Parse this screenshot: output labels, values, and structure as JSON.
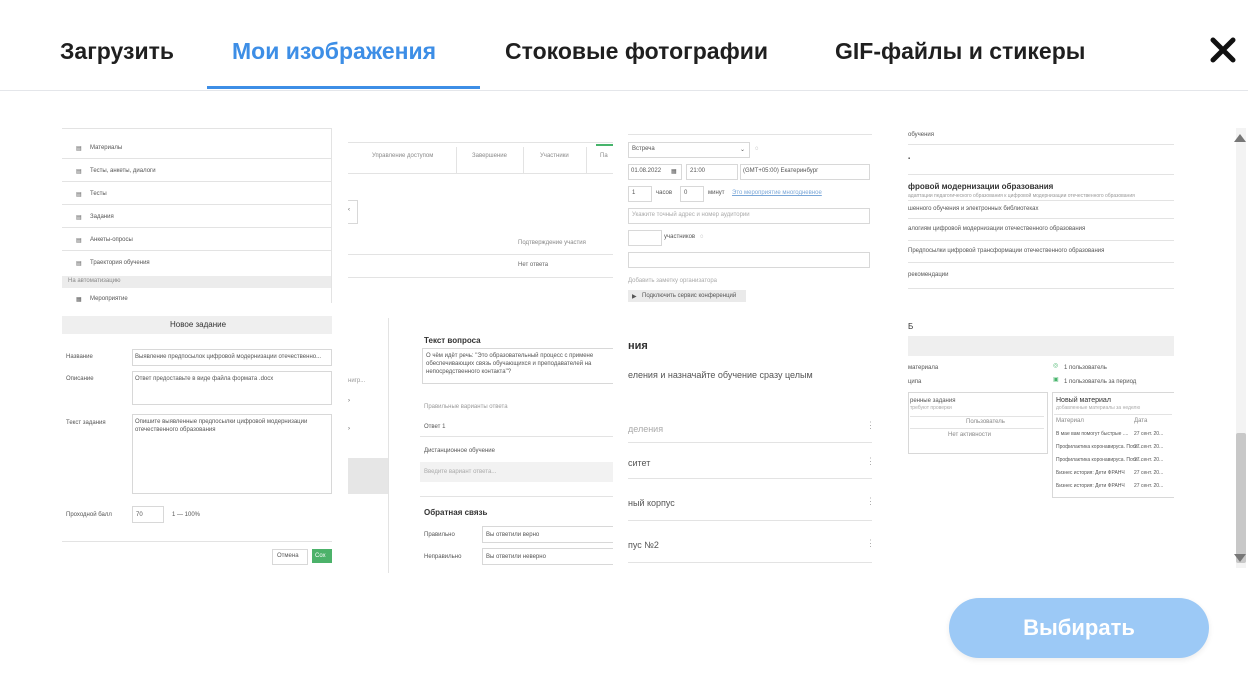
{
  "tabs": [
    {
      "label": "Загрузить"
    },
    {
      "label": "Мои изображения"
    },
    {
      "label": "Стоковые фотографии"
    },
    {
      "label": "GIF-файлы и стикеры"
    }
  ],
  "close_icon": "close-icon",
  "accent_color": "#3d8ee6",
  "button": {
    "select_label": "Выбирать",
    "color": "#9cc9f6"
  },
  "thumbs": {
    "t1": {
      "items": [
        "Материалы",
        "Тесты, анкеты, диалоги",
        "Тесты",
        "Задания",
        "Анкеты-опросы",
        "Траектория обучения"
      ],
      "section": "На автоматизацию",
      "last": "Мероприятие"
    },
    "t2": {
      "tabs": [
        "Управление доступом",
        "Завершение",
        "Участники",
        "Па"
      ],
      "confirm": "Подтверждение участия",
      "no_answer": "Нет ответа"
    },
    "t3": {
      "type": "Встреча",
      "date": "01.08.2022",
      "time": "21:00",
      "tz": "(GMT+05:00) Екатеринбург",
      "dur_h": "1",
      "hours": "часов",
      "dur_m": "0",
      "minutes": "минут",
      "link": "Это мероприятие многодневное",
      "addr_ph": "Укажите точный адрес и номер аудитории",
      "participants": "участников",
      "add_note": "Добавить заметку организатора",
      "conf_btn": "Подключить сервис конференций"
    },
    "t4": {
      "top1": "обучения",
      "title": "фровой модернизации образования",
      "sub": "адаптации педагогического образования к цифровой модернизации отечественного образования",
      "l1": "шенного обучения и электронных библиотеках",
      "l2": "алогиям цифровой модернизации отечественного образования",
      "l3": "Предпосылки цифровой трансформации отечественного образования",
      "l4": "рекомендации"
    },
    "t5": {
      "header": "Новое задание",
      "name_label": "Название",
      "name_val": "Выявление предпосылок цифровой модернизации отечественно...",
      "desc_label": "Описание",
      "desc_val": "Ответ предоставьте в виде файла формата .docx",
      "text_label": "Текст задания",
      "text_val1": "Опишите выявленные предпосылки цифровой модернизации",
      "text_val2": "отечественного образования",
      "pass_label": "Проходной балл",
      "pass_val": "70",
      "pass_range": "1 — 100%",
      "cancel": "Отмена",
      "save": "Сох"
    },
    "t6": {
      "question_label": "Текст вопроса",
      "question1": "О чём идёт речь: \"Это образовательный процесс с примене",
      "question2": "обеспечивающих связь обучающихся и преподавателей на",
      "question3": "непосредственного контакта\"?",
      "correct_label": "Правильные варианты ответа",
      "ans1": "Ответ 1",
      "ans2": "Дистанционное обучение",
      "ans_ph": "Введите вариант ответа...",
      "feedback": "Обратная связь",
      "right": "Правильно",
      "right_val": "Вы ответили верно",
      "wrong": "Неправильно",
      "wrong_val": "Вы ответили неверно",
      "left1": "нигр...",
      "left2": "›",
      "left3": "›"
    },
    "t7": {
      "heading": "ния",
      "sub": "еления и назначайте обучение сразу целым",
      "r1": "деления",
      "r2": "ситет",
      "r3": "ный корпус",
      "r4": "пус №2"
    },
    "t8": {
      "letter": "Б",
      "mat": "материала",
      "one_user": "1 пользователь",
      "part": "ципа",
      "one_period": "1 пользователь за период",
      "tasks": "ренные задания",
      "tasks_sub": "требуют проверки",
      "col_user": "Пользователь",
      "col_act": "Нет активности",
      "new_mat": "Новый материал",
      "new_sub": "добавленные материалы за неделю",
      "m_head": "Материал",
      "m_date": "Дата",
      "rows": [
        "В мае вам помогут быстрые ....",
        "Профилактика коронавируса. Поте...",
        "Профилактика коронавируса. Поте...",
        "Бизнес история: Дети ФРАНЧ",
        "Бизнес история: Дети ФРАНЧ"
      ],
      "row_date": "27 сент. 20..."
    }
  }
}
